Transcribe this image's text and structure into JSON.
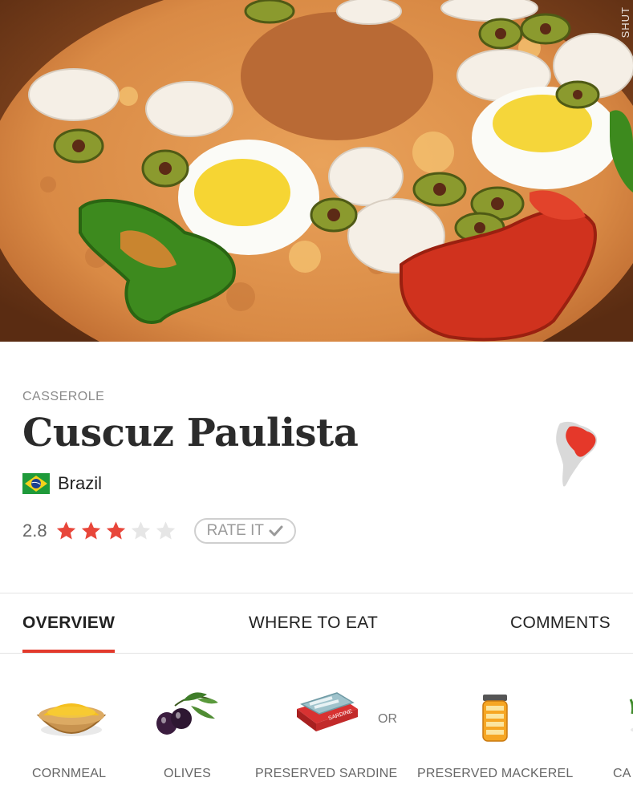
{
  "hero": {
    "image_alt": "Cuscuz Paulista dish with eggs, olives, hearts of palm and peppers",
    "watermark": "SHUT"
  },
  "dish": {
    "category": "CASSEROLE",
    "name": "Cuscuz Paulista",
    "country": "Brazil",
    "rating": "2.8",
    "rating_value": 2.8,
    "rating_max": 5,
    "rate_label": "RATE IT"
  },
  "tabs": [
    {
      "label": "OVERVIEW",
      "active": true
    },
    {
      "label": "WHERE TO EAT",
      "active": false
    },
    {
      "label": "COMMENTS",
      "active": false
    }
  ],
  "ingredients": [
    {
      "label": "CORNMEAL",
      "icon": "cornmeal-bowl-icon"
    },
    {
      "label": "OLIVES",
      "icon": "olives-icon"
    },
    {
      "label": "PRESERVED SARDINE",
      "icon": "sardine-can-icon"
    },
    {
      "label": "PRESERVED MACKEREL",
      "icon": "mackerel-jar-icon"
    },
    {
      "label": "CA",
      "icon": "partial-ingredient-icon"
    }
  ],
  "or_label": "OR",
  "colors": {
    "accent": "#e23a2c",
    "star_on": "#e8463a",
    "star_off": "#e6e6e6",
    "text_dark": "#2b2b2b",
    "text_muted": "#8a8a8a"
  }
}
